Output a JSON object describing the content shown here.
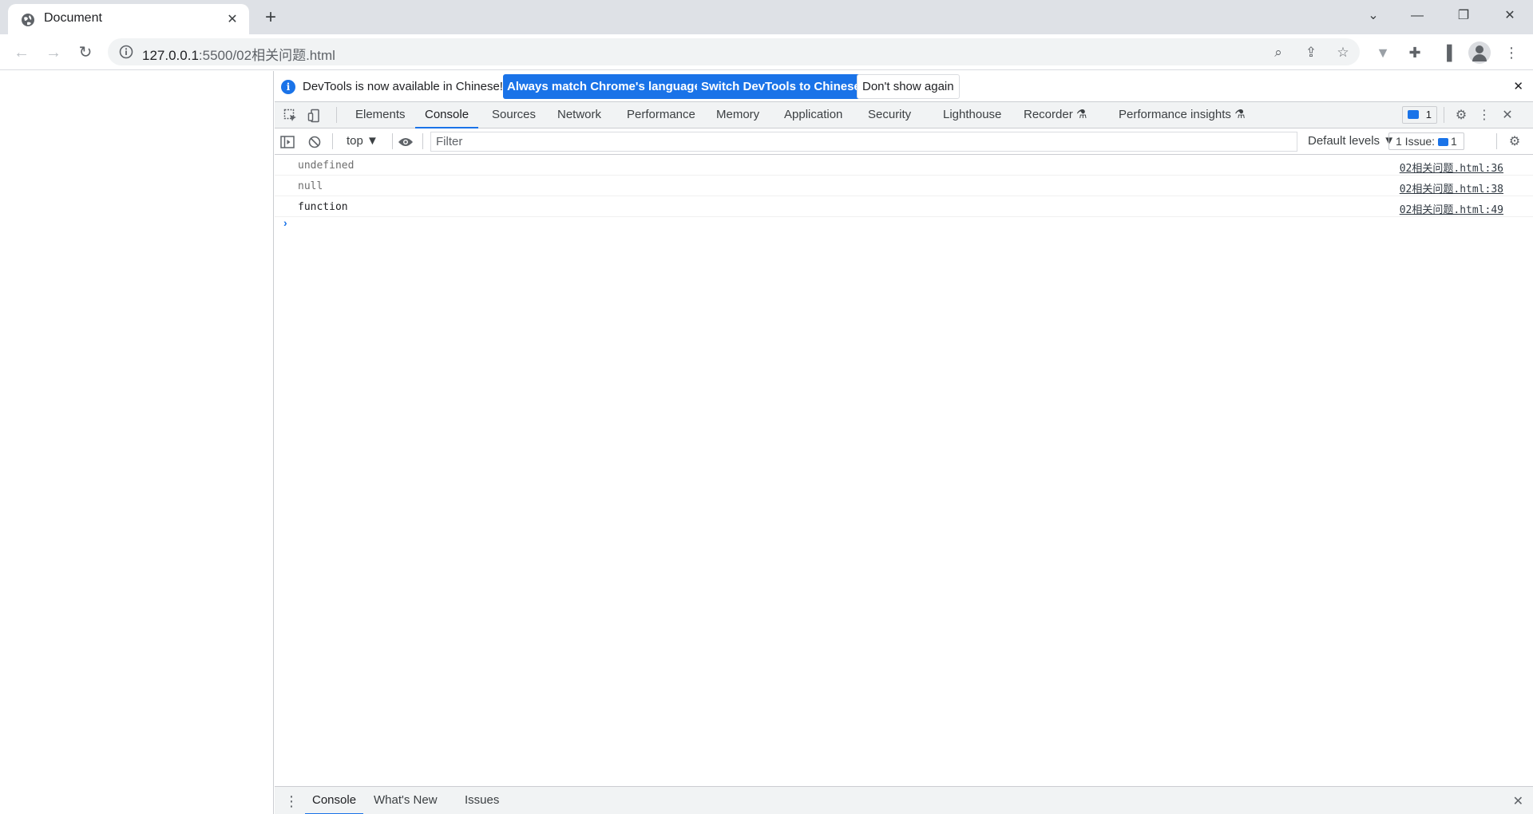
{
  "browser": {
    "tab_title": "Document",
    "url_host": "127.0.0.1",
    "url_rest": ":5500/02相关问题.html"
  },
  "infobar": {
    "message": "DevTools is now available in Chinese!",
    "btn_match": "Always match Chrome's language",
    "btn_switch": "Switch DevTools to Chinese",
    "btn_dont": "Don't show again"
  },
  "tabs": [
    "Elements",
    "Console",
    "Sources",
    "Network",
    "Performance",
    "Memory",
    "Application",
    "Security",
    "Lighthouse",
    "Recorder",
    "Performance insights"
  ],
  "active_tab": "Console",
  "message_count": "1",
  "console_toolbar": {
    "context": "top",
    "filter_placeholder": "Filter",
    "levels": "Default levels",
    "issues_label": "1 Issue:",
    "issues_count": "1"
  },
  "logs": [
    {
      "message": "undefined",
      "source": "02相关问题.html:36",
      "color": "#6e6e6e"
    },
    {
      "message": "null",
      "source": "02相关问题.html:38",
      "color": "#6e6e6e"
    },
    {
      "message": "function",
      "source": "02相关问题.html:49",
      "color": "#202124"
    }
  ],
  "drawer": {
    "tabs": [
      "Console",
      "What's New",
      "Issues"
    ]
  },
  "colors": {
    "accent": "#1a73e8",
    "toolbar_bg": "#f1f3f4",
    "tabstrip_bg": "#dee1e6"
  }
}
